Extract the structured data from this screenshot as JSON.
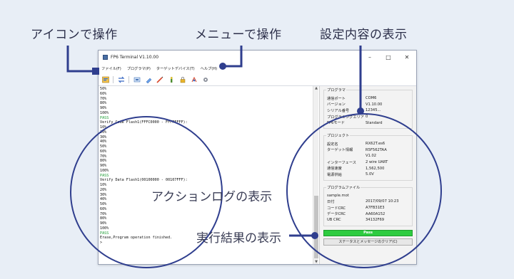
{
  "callouts": {
    "icon_ops": "アイコンで操作",
    "menu_ops": "メニューで操作",
    "settings_view": "設定内容の表示",
    "action_log": "アクションログの表示",
    "result_view": "実行結果の表示"
  },
  "window": {
    "title": "FP6 Terminal V1.10.00",
    "controls": [
      "–",
      "□",
      "✕"
    ]
  },
  "menu": [
    "ファイル(F)",
    "プログラマ(P)",
    "ターゲットデバイス(T)",
    "ヘルプ(H)"
  ],
  "toolbar": [
    "open-icon",
    "connect-icon",
    "read-icon",
    "erase-icon",
    "write-icon",
    "verify-icon",
    "lock-icon",
    "auto-icon",
    "settings-icon"
  ],
  "log_lines": [
    {
      "t": "50%",
      "p": false
    },
    {
      "t": "60%",
      "p": false
    },
    {
      "t": "70%",
      "p": false
    },
    {
      "t": "80%",
      "p": false
    },
    {
      "t": "90%",
      "p": false
    },
    {
      "t": "100%",
      "p": false
    },
    {
      "t": "PASS",
      "p": true
    },
    {
      "t": "Verify Code Flash1(FFFC0000 - FFFFFFFF):",
      "p": false
    },
    {
      "t": "10%",
      "p": false
    },
    {
      "t": "20%",
      "p": false
    },
    {
      "t": "30%",
      "p": false
    },
    {
      "t": "40%",
      "p": false
    },
    {
      "t": "50%",
      "p": false
    },
    {
      "t": "60%",
      "p": false
    },
    {
      "t": "70%",
      "p": false
    },
    {
      "t": "80%",
      "p": false
    },
    {
      "t": "90%",
      "p": false
    },
    {
      "t": "100%",
      "p": false
    },
    {
      "t": "PASS",
      "p": true
    },
    {
      "t": "Verify Data Flash1(00100000 - 00107FFF):",
      "p": false
    },
    {
      "t": "10%",
      "p": false
    },
    {
      "t": "20%",
      "p": false
    },
    {
      "t": "30%",
      "p": false
    },
    {
      "t": "40%",
      "p": false
    },
    {
      "t": "50%",
      "p": false
    },
    {
      "t": "60%",
      "p": false
    },
    {
      "t": "70%",
      "p": false
    },
    {
      "t": "80%",
      "p": false
    },
    {
      "t": "90%",
      "p": false
    },
    {
      "t": "100%",
      "p": false
    },
    {
      "t": "PASS",
      "p": true
    },
    {
      "t": "Erase,Program operation finished.",
      "p": false
    },
    {
      "t": ">",
      "p": false
    }
  ],
  "panel": {
    "programmer": {
      "title": "プログラマ",
      "rows": [
        {
          "k": "通信ポート",
          "v": "COM6"
        },
        {
          "k": "バージョン",
          "v": "V1.10.00"
        },
        {
          "k": "シリアル番号",
          "v": "12345..."
        },
        {
          "k": "プログラミングエリア",
          "v": "0"
        },
        {
          "k": "FP6モード",
          "v": "Standard"
        }
      ]
    },
    "project": {
      "title": "プロジェクト",
      "rows": [
        {
          "k": "設定名",
          "v": "RX62T.es6"
        },
        {
          "k": "ターゲット情報",
          "v": "R5F562TAA"
        },
        {
          "k": "",
          "v": "V1.02"
        },
        {
          "k": "インターフェース",
          "v": "2 wire UART"
        },
        {
          "k": "通信速度",
          "v": "1,562,500"
        },
        {
          "k": "電源供給",
          "v": "5.0V"
        }
      ]
    },
    "file": {
      "title": "プログラムファイル",
      "name": "sample.mot",
      "rows": [
        {
          "k": "日付",
          "v": "2017/09/07 10:23"
        },
        {
          "k": "コードCRC",
          "v": "A7FB31E3"
        },
        {
          "k": "データCRC",
          "v": "AA60A152"
        },
        {
          "k": "UB CRC",
          "v": "34132F69"
        }
      ]
    },
    "status": "Pass",
    "clear_button": "ステータスとメッセージのクリア(C)"
  },
  "colors": {
    "accent": "#2f3e8e",
    "pass": "#2ecc40",
    "pass_text": "#1f9d35"
  }
}
